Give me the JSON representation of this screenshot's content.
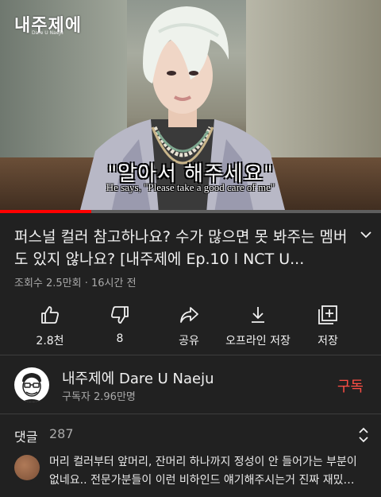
{
  "video": {
    "channel_logo": "내주제에",
    "channel_logo_sub": "Dare U Naeju",
    "subtitle_ko": "\"알아서 해주세요\"",
    "subtitle_en": "He says, \"Please take a good care of me\"",
    "progress_fraction": 0.24
  },
  "title": "퍼스널 컬러 참고하나요? 수가 많으면 못 봐주는 멤버도 있지 않나요? [내주제에 Ep.10 l NCT U...",
  "meta": "조회수 2.5만회 · 16시간 전",
  "actions": [
    {
      "icon": "thumbs-up-icon",
      "label": "2.8천"
    },
    {
      "icon": "thumbs-down-icon",
      "label": "8"
    },
    {
      "icon": "share-icon",
      "label": "공유"
    },
    {
      "icon": "download-icon",
      "label": "오프라인 저장"
    },
    {
      "icon": "save-playlist-icon",
      "label": "저장"
    }
  ],
  "channel": {
    "name": "내주제에 Dare U Naeju",
    "subscribers": "구독자 2.96만명",
    "subscribe_label": "구독"
  },
  "comments": {
    "label": "댓글",
    "count": "287",
    "top_comment": "머리 컬러부터 앞머리, 잔머리 하나까지 정성이 안 들어가는 부분이 없네요.. 전문가분들이 이런 비하인드 얘기해주시는거 진짜 재밌…"
  },
  "colors": {
    "background": "#212121",
    "accent_red": "#ff0000",
    "subscribe": "#ff4e45",
    "secondary_text": "#aaaaaa"
  }
}
